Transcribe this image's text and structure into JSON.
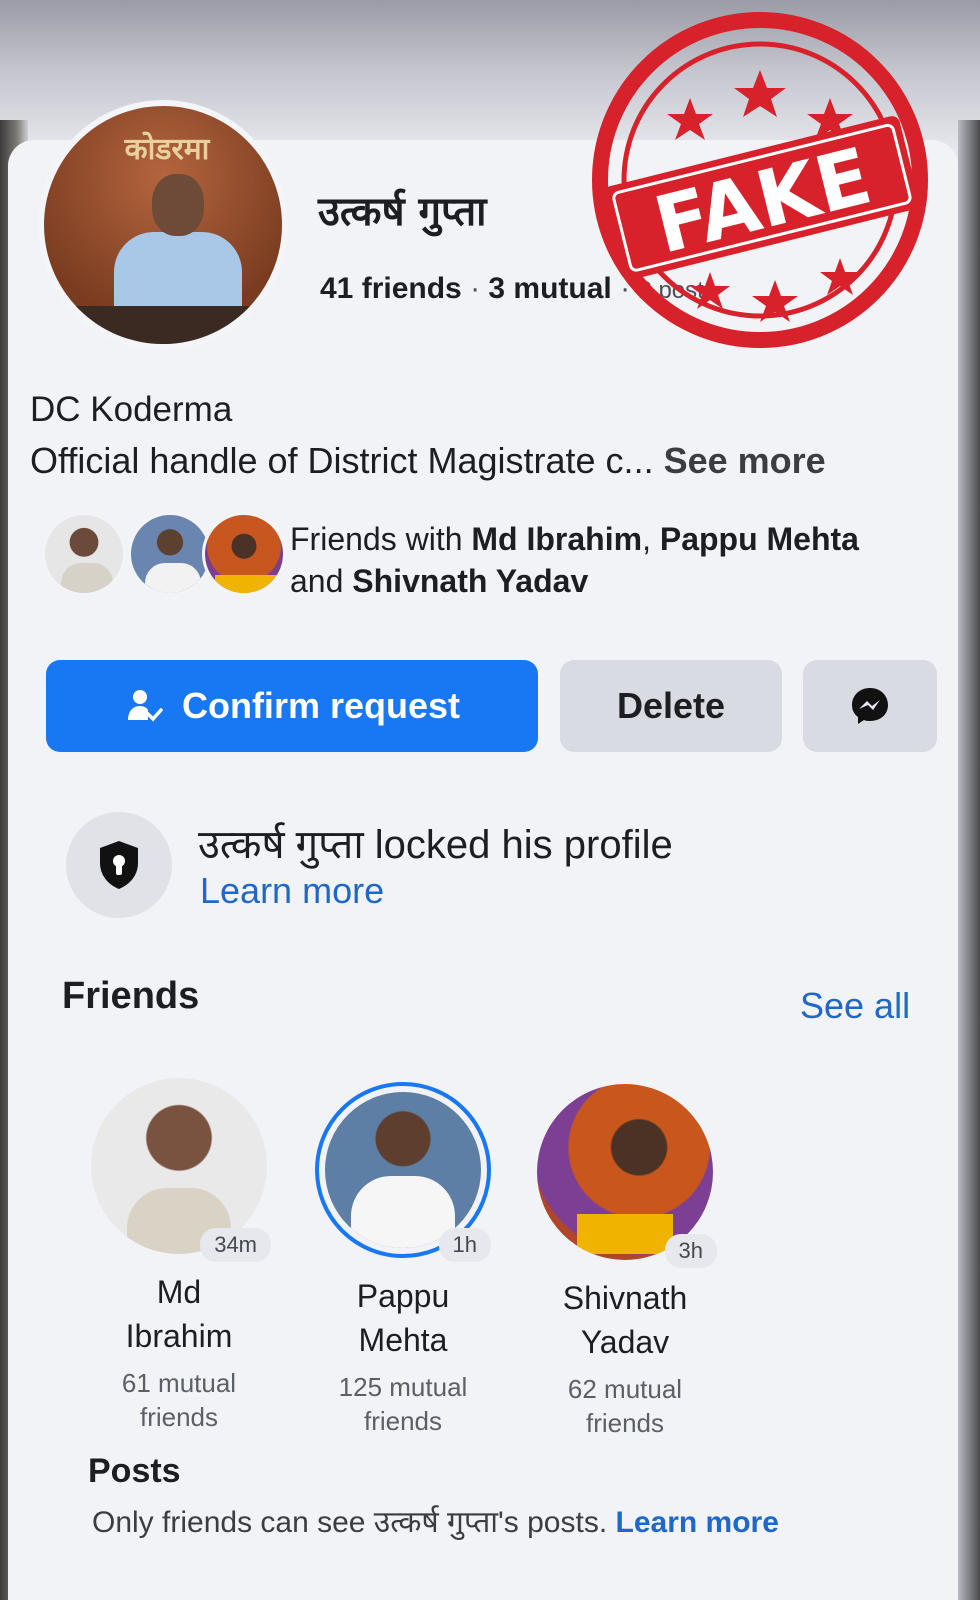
{
  "profile": {
    "avatar_sign": "कोडरमा",
    "name": "उत्कर्ष गुप्ता",
    "friends_count": "41 friends",
    "sep1": " · ",
    "mutual_count": "3 mutual",
    "sep2": " · ",
    "posts_count": "2 posts",
    "bio_title": "DC Koderma",
    "bio_text": "Official handle of District Magistrate c... ",
    "see_more": "See more"
  },
  "stamp": {
    "label": "FAKE",
    "color": "#d8222b"
  },
  "mutual_friends": {
    "prefix": "Friends with ",
    "name1": "Md Ibrahim",
    "sep": ", ",
    "name2": "Pappu Mehta",
    "and": "and ",
    "name3": "Shivnath Yadav"
  },
  "actions": {
    "confirm_label": "Confirm request",
    "delete_label": "Delete",
    "accent": "#1877f2"
  },
  "lock_notice": {
    "text": "उत्कर्ष गुप्ता locked his profile",
    "learn_more": "Learn more"
  },
  "friends_section": {
    "title": "Friends",
    "see_all": "See all",
    "friends": [
      {
        "first": "Md",
        "last": "Ibrahim",
        "time": "34m",
        "mutual1": "61 mutual",
        "mutual2": "friends"
      },
      {
        "first": "Pappu",
        "last": "Mehta",
        "time": "1h",
        "mutual1": "125 mutual",
        "mutual2": "friends"
      },
      {
        "first": "Shivnath",
        "last": "Yadav",
        "time": "3h",
        "mutual1": "62 mutual",
        "mutual2": "friends"
      }
    ]
  },
  "posts_section": {
    "title": "Posts",
    "text": "Only friends can see उत्कर्ष गुप्ता's posts. ",
    "learn_more": "Learn more"
  }
}
